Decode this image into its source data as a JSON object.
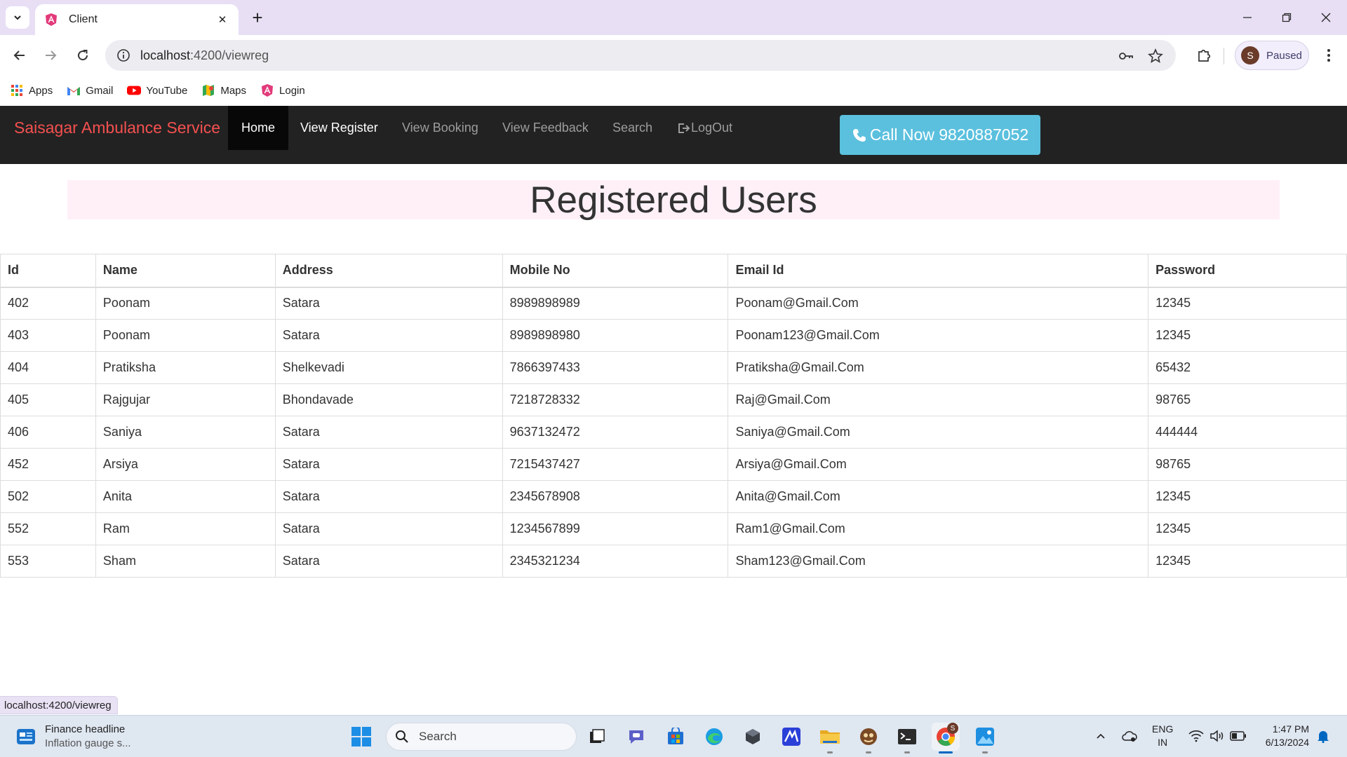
{
  "browser": {
    "tab": {
      "title": "Client",
      "close_glyph": "✕"
    },
    "new_tab_glyph": "+",
    "address": {
      "host": "localhost",
      "path": ":4200/viewreg"
    },
    "profile": {
      "initial": "S",
      "label": "Paused"
    },
    "bookmarks": [
      {
        "label": "Apps",
        "icon": "apps-grid-icon"
      },
      {
        "label": "Gmail",
        "icon": "gmail-icon"
      },
      {
        "label": "YouTube",
        "icon": "youtube-icon"
      },
      {
        "label": "Maps",
        "icon": "maps-icon"
      },
      {
        "label": "Login",
        "icon": "angular-icon"
      }
    ],
    "status_url": "localhost:4200/viewreg"
  },
  "navbar": {
    "brand": "Saisagar Ambulance Service",
    "links": [
      "Home",
      "View Register",
      "View Booking",
      "View Feedback",
      "Search",
      "LogOut"
    ],
    "call_button": "Call Now 9820887052"
  },
  "page": {
    "heading": "Registered Users",
    "table": {
      "columns": [
        "Id",
        "Name",
        "Address",
        "Mobile No",
        "Email Id",
        "Password"
      ],
      "rows": [
        [
          "402",
          "Poonam",
          "Satara",
          "8989898989",
          "Poonam@Gmail.Com",
          "12345"
        ],
        [
          "403",
          "Poonam",
          "Satara",
          "8989898980",
          "Poonam123@Gmail.Com",
          "12345"
        ],
        [
          "404",
          "Pratiksha",
          "Shelkevadi",
          "7866397433",
          "Pratiksha@Gmail.Com",
          "65432"
        ],
        [
          "405",
          "Rajgujar",
          "Bhondavade",
          "7218728332",
          "Raj@Gmail.Com",
          "98765"
        ],
        [
          "406",
          "Saniya",
          "Satara",
          "9637132472",
          "Saniya@Gmail.Com",
          "444444"
        ],
        [
          "452",
          "Arsiya",
          "Satara",
          "7215437427",
          "Arsiya@Gmail.Com",
          "98765"
        ],
        [
          "502",
          "Anita",
          "Satara",
          "2345678908",
          "Anita@Gmail.Com",
          "12345"
        ],
        [
          "552",
          "Ram",
          "Satara",
          "1234567899",
          "Ram1@Gmail.Com",
          "12345"
        ],
        [
          "553",
          "Sham",
          "Satara",
          "2345321234",
          "Sham123@Gmail.Com",
          "12345"
        ]
      ]
    }
  },
  "taskbar": {
    "widget": {
      "title": "Finance headline",
      "subtitle": "Inflation gauge s..."
    },
    "search_label": "Search",
    "language": {
      "line1": "ENG",
      "line2": "IN"
    },
    "clock": {
      "time": "1:47 PM",
      "date": "6/13/2024"
    },
    "chrome_badge": "S"
  },
  "colors": {
    "brand": "#f55050",
    "navbar_bg": "#222222",
    "call_button": "#5bc0de",
    "heading_bg": "#fff0f8",
    "tabstrip": "#e8dff5"
  }
}
